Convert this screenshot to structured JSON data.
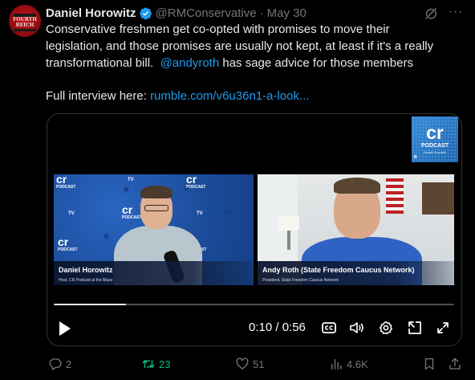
{
  "author": {
    "display_name": "Daniel Horowitz",
    "handle": "@RMConservative",
    "date": "May 30",
    "avatar_text": "FOURTH REICH"
  },
  "tweet": {
    "lines": [
      "Conservative freshmen get co-opted with promises to move their",
      "legislation, and those promises are usually not kept, at least if it's a really",
      "transformational bill."
    ],
    "mention": "@andyroth",
    "mention_suffix": " has sage advice for those members",
    "link_prefix": "Full interview here: ",
    "link": "rumble.com/v6u36n1-a-look..."
  },
  "video": {
    "badge": {
      "logo": "cr",
      "title": "PODCAST",
      "subtitle": "Daniel Horowitz",
      "network": "B"
    },
    "left_panel": {
      "name": "Daniel Horowitz",
      "title": "Host, CR Podcast at the Blaze",
      "logo": "cr",
      "logo_sub": "PODCAST",
      "tv_label": "TV"
    },
    "right_panel": {
      "name": "Andy Roth (State Freedom Caucus Network)",
      "title": "President, State Freedom Caucus Network"
    },
    "progress": 0.18,
    "time": "0:10 / 0:56",
    "controls": [
      "play-icon",
      "captions-icon",
      "volume-icon",
      "settings-icon",
      "pip-icon",
      "fullscreen-icon"
    ]
  },
  "actions": {
    "replies": "2",
    "reposts": "23",
    "likes": "51",
    "views": "4.6K"
  },
  "colors": {
    "accent": "#1d9bf0",
    "repost_active": "#00ba7c",
    "muted": "#71767b",
    "background": "#000000"
  }
}
